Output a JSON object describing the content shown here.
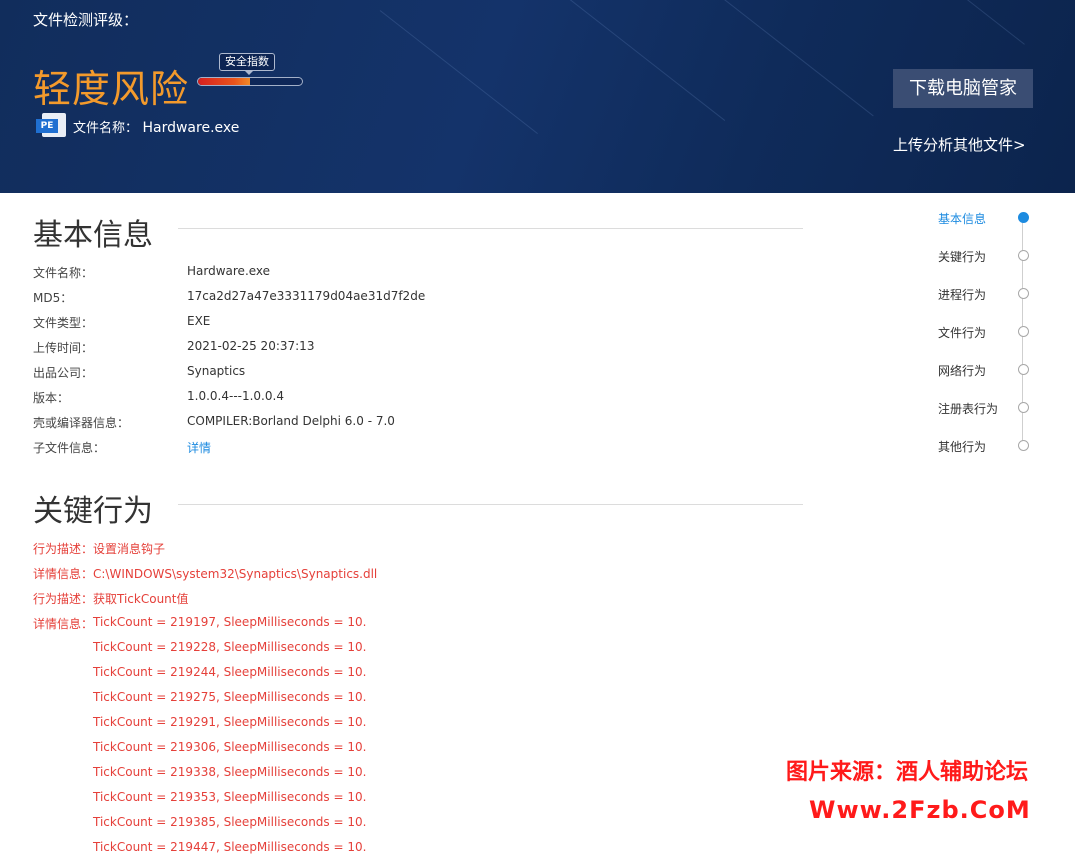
{
  "header": {
    "title": "文件检测评级：",
    "risk_level": "轻度风险",
    "safety_index_label": "安全指数",
    "safety_index_fraction": 0.5,
    "file_type_badge": "PE",
    "file_name_label": "文件名称：",
    "file_name": "Hardware.exe",
    "download_button": "下载电脑管家",
    "upload_link": "上传分析其他文件>"
  },
  "basic_info": {
    "title": "基本信息",
    "rows": [
      {
        "key": "文件名称：",
        "value": "Hardware.exe"
      },
      {
        "key": "MD5：",
        "value": "17ca2d27a47e3331179d04ae31d7f2de"
      },
      {
        "key": "文件类型：",
        "value": "EXE"
      },
      {
        "key": "上传时间：",
        "value": "2021-02-25 20:37:13"
      },
      {
        "key": "出品公司：",
        "value": "Synaptics"
      },
      {
        "key": "版本：",
        "value": "1.0.0.4---1.0.0.4"
      },
      {
        "key": "壳或编译器信息：",
        "value": "COMPILER:Borland Delphi 6.0 - 7.0"
      },
      {
        "key": "子文件信息：",
        "value": "详情"
      }
    ]
  },
  "key_behavior": {
    "title": "关键行为",
    "lines": [
      "行为描述：设置消息钩子",
      "详情信息：C:\\WINDOWS\\system32\\Synaptics\\Synaptics.dll",
      "行为描述：获取TickCount值",
      "详情信息："
    ],
    "tick_details": [
      "TickCount = 219197, SleepMilliseconds = 10.",
      "TickCount = 219228, SleepMilliseconds = 10.",
      "TickCount = 219244, SleepMilliseconds = 10.",
      "TickCount = 219275, SleepMilliseconds = 10.",
      "TickCount = 219291, SleepMilliseconds = 10.",
      "TickCount = 219306, SleepMilliseconds = 10.",
      "TickCount = 219338, SleepMilliseconds = 10.",
      "TickCount = 219353, SleepMilliseconds = 10.",
      "TickCount = 219385, SleepMilliseconds = 10.",
      "TickCount = 219447, SleepMilliseconds = 10."
    ]
  },
  "side_nav": {
    "items": [
      "基本信息",
      "关键行为",
      "进程行为",
      "文件行为",
      "网络行为",
      "注册表行为",
      "其他行为"
    ],
    "active_index": 0
  },
  "watermark": {
    "line1": "图片来源：酒人辅助论坛",
    "line2": "Www.2Fzb.CoM"
  },
  "colors": {
    "header_bg": "#13306a",
    "risk": "#f39a2c",
    "behavior_text": "#e5403a",
    "link": "#1d8be0",
    "watermark": "#ff1a1a"
  }
}
